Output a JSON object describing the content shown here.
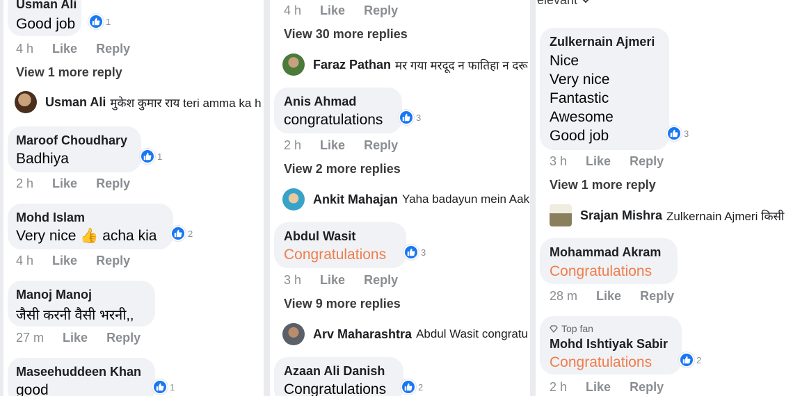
{
  "col1": {
    "c1": {
      "author": "Usman Ali",
      "text": "Good job",
      "reactions": "1",
      "time": "4 h"
    },
    "c1_more": "View 1 more reply",
    "c1_reply": {
      "name": "Usman Ali",
      "text": "मुकेश कुमार राय teri amma ka h"
    },
    "c2": {
      "author": "Maroof Choudhary",
      "text": "Badhiya",
      "reactions": "1",
      "time": "2 h"
    },
    "c3": {
      "author": "Mohd Islam",
      "text": "Very nice 👍 acha kia",
      "reactions": "2",
      "time": "4 h"
    },
    "c4": {
      "author": "Manoj Manoj",
      "text": "जैसी करनी वैसी भरनी,,",
      "time": "27 m"
    },
    "c5": {
      "author": "Maseehuddeen Khan",
      "text": "good",
      "reactions": "1"
    }
  },
  "col2": {
    "c0": {
      "time": "4 h"
    },
    "c0_more": "View 30 more replies",
    "c0_reply": {
      "name": "Faraz Pathan",
      "text": "मर गया मरदूद न फातिहा न दरू"
    },
    "c1": {
      "author": "Anis Ahmad",
      "text": "congratulations",
      "reactions": "3",
      "time": "2 h"
    },
    "c1_more": "View 2 more replies",
    "c1_reply": {
      "name": "Ankit Mahajan",
      "text": "Yaha badayun mein Aak"
    },
    "c2": {
      "author": "Abdul Wasit",
      "text": "Congratulations",
      "reactions": "3",
      "time": "3 h"
    },
    "c2_more": "View 9 more replies",
    "c2_reply": {
      "name": "Arv Maharashtra",
      "text": "Abdul Wasit congratu"
    },
    "c3": {
      "author": "Azaan Ali Danish",
      "text": "Congratulations",
      "reactions": "2"
    }
  },
  "col3": {
    "header": "elevant",
    "c1": {
      "author": "Zulkernain Ajmeri",
      "lines": [
        "Nice",
        "Very nice",
        "Fantastic",
        "Awesome",
        "Good job"
      ],
      "reactions": "3",
      "time": "3 h"
    },
    "c1_more": "View 1 more reply",
    "c1_reply": {
      "name": "Srajan Mishra",
      "text": "Zulkernain Ajmeri  किसी"
    },
    "c2": {
      "author": "Mohammad Akram",
      "text": "Congratulations",
      "time": "28 m"
    },
    "c3": {
      "badge": "Top fan",
      "author": "Mohd Ishtiyak Sabir",
      "text": "Congratulations",
      "reactions": "2",
      "time": "2 h"
    }
  },
  "actions": {
    "like": "Like",
    "reply": "Reply"
  },
  "colors": {
    "like_blue": "#1877f2",
    "orange_text": "#f07d4c",
    "bubble": "#f0f2f5",
    "meta_gray": "#8a8d91"
  }
}
